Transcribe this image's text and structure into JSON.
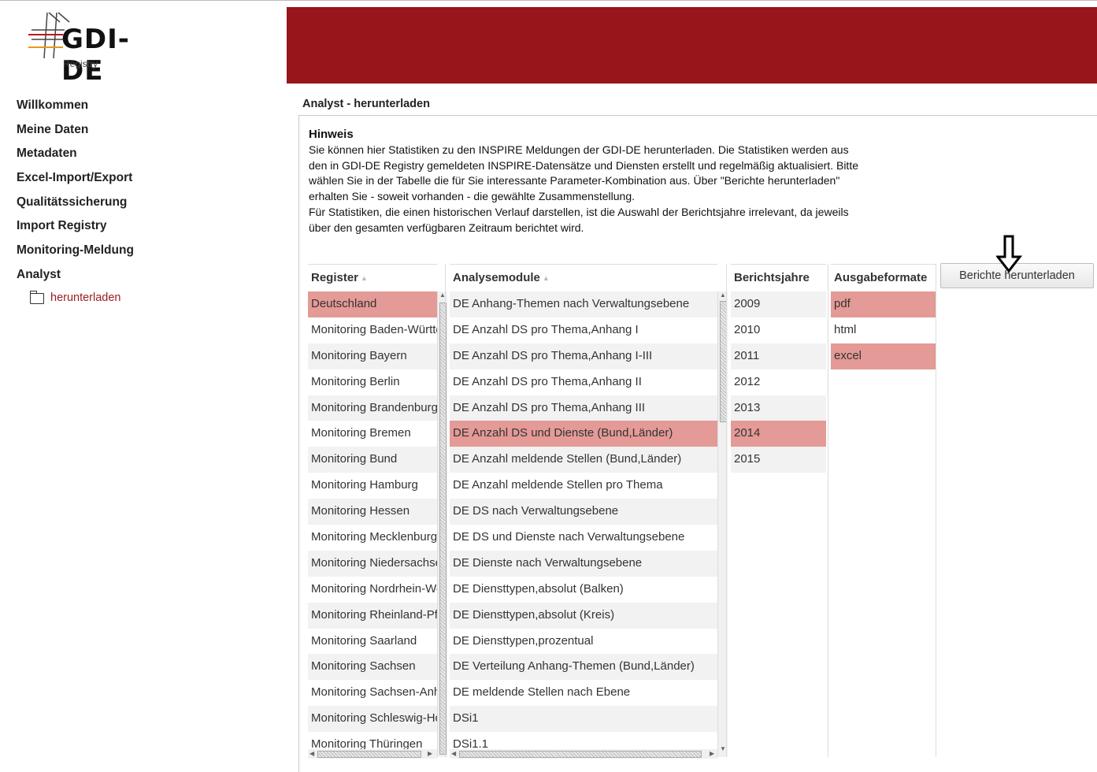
{
  "brand": {
    "title": "GDI-DE",
    "subtitle": "Registry",
    "banner_color": "#98151b"
  },
  "nav": {
    "items": [
      "Willkommen",
      "Meine Daten",
      "Metadaten",
      "Excel-Import/Export",
      "Qualitätssicherung",
      "Import Registry",
      "Monitoring-Meldung",
      "Analyst"
    ],
    "sub_item": "herunterladen"
  },
  "content": {
    "title": "Analyst - herunterladen",
    "hint_title": "Hinweis",
    "hint_lines": [
      "Sie können hier Statistiken zu den INSPIRE Meldungen der GDI-DE herunterladen. Die Statistiken werden aus",
      "den in GDI-DE Registry gemeldeten INSPIRE-Datensätze und Diensten erstellt und regelmäßig aktualisiert. Bitte",
      "wählen Sie in der Tabelle die für Sie interessante Parameter-Kombination aus. Über \"Berichte herunterladen\"",
      "erhalten Sie - soweit vorhanden - die gewählte Zusammenstellung.",
      "Für Statistiken, die einen historischen Verlauf darstellen, ist die Auswahl der Berichtsjahre irrelevant, da jeweils",
      "über den gesamten verfügbaren Zeitraum berichtet wird."
    ]
  },
  "table": {
    "register": {
      "header": "Register",
      "rows": [
        "Deutschland",
        "Monitoring Baden-Württemberg",
        "Monitoring Bayern",
        "Monitoring Berlin",
        "Monitoring Brandenburg",
        "Monitoring Bremen",
        "Monitoring Bund",
        "Monitoring Hamburg",
        "Monitoring Hessen",
        "Monitoring Mecklenburg",
        "Monitoring Niedersachsen",
        "Monitoring Nordrhein-Westfalen",
        "Monitoring Rheinland-Pfalz",
        "Monitoring Saarland",
        "Monitoring Sachsen",
        "Monitoring Sachsen-Anhalt",
        "Monitoring Schleswig-Holstein",
        "Monitoring Thüringen"
      ],
      "selected": [
        0
      ]
    },
    "analysemodule": {
      "header": "Analysemodule",
      "rows": [
        "DE Anhang-Themen nach Verwaltungsebene",
        "DE Anzahl DS pro Thema,Anhang I",
        "DE Anzahl DS pro Thema,Anhang I-III",
        "DE Anzahl DS pro Thema,Anhang II",
        "DE Anzahl DS pro Thema,Anhang III",
        "DE Anzahl DS und Dienste (Bund,Länder)",
        "DE Anzahl meldende Stellen (Bund,Länder)",
        "DE Anzahl meldende Stellen pro Thema",
        "DE DS nach Verwaltungsebene",
        "DE DS und Dienste nach Verwaltungsebene",
        "DE Dienste nach Verwaltungsebene",
        "DE Diensttypen,absolut (Balken)",
        "DE Diensttypen,absolut (Kreis)",
        "DE Diensttypen,prozentual",
        "DE Verteilung Anhang-Themen (Bund,Länder)",
        "DE meldende Stellen nach Ebene",
        "DSi1",
        "DSi1.1"
      ],
      "selected": [
        5
      ]
    },
    "berichtsjahre": {
      "header": "Berichtsjahre",
      "rows": [
        "2009",
        "2010",
        "2011",
        "2012",
        "2013",
        "2014",
        "2015"
      ],
      "selected": [
        5
      ]
    },
    "ausgabeformate": {
      "header": "Ausgabeformate",
      "rows": [
        "pdf",
        "html",
        "excel"
      ],
      "selected": [
        0,
        2
      ]
    }
  },
  "download_button": "Berichte herunterladen"
}
